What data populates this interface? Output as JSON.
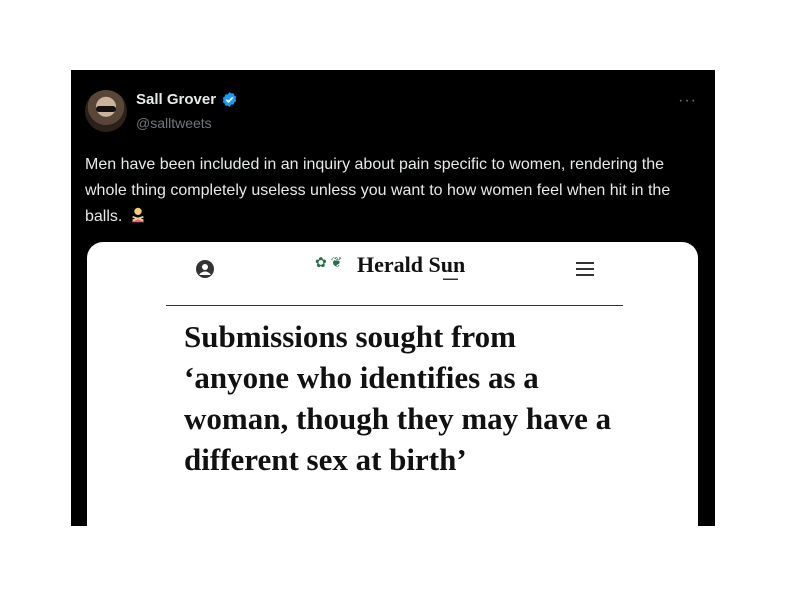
{
  "tweet": {
    "author_name": "Sall Grover",
    "author_handle": "@salltweets",
    "more_label": "···",
    "text": "Men have been included in an inquiry about pain specific to women, rendering the whole thing completely useless unless you want to how women feel when hit in the balls.",
    "emoji": "person-gesturing-no",
    "verified_color": "#1d9bf0"
  },
  "media": {
    "masthead": "Herald Sun",
    "headline": "Submissions sought from ‘anyone who identifies as a woman, though they may have a different sex at birth’"
  }
}
